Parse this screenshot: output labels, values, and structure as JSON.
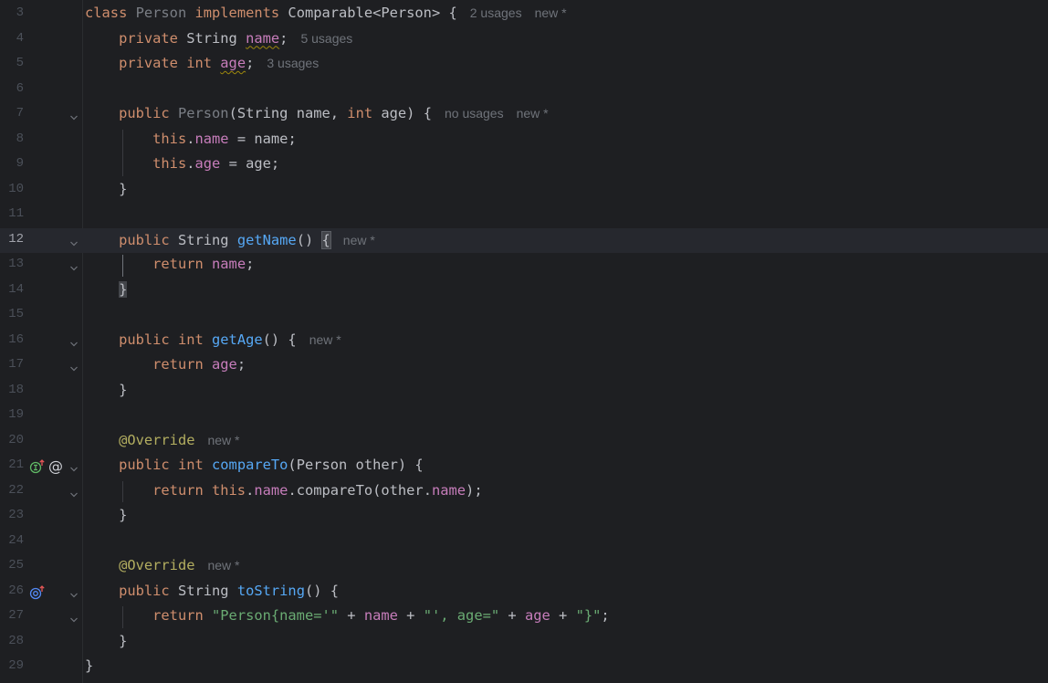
{
  "editor": {
    "current_line": 12,
    "lines": [
      {
        "num": "3",
        "tokens": [
          [
            "kw",
            "class "
          ],
          [
            "unused",
            "Person "
          ],
          [
            "kw",
            "implements "
          ],
          [
            "plain",
            "Comparable<Person> {"
          ]
        ],
        "hints": [
          "2 usages",
          "new *"
        ]
      },
      {
        "num": "4",
        "tokens": [
          [
            "plain",
            "    "
          ],
          [
            "kw",
            "private "
          ],
          [
            "plain",
            "String "
          ],
          [
            "fld sq",
            "name"
          ],
          [
            "plain",
            ";"
          ]
        ],
        "hints": [
          "5 usages"
        ]
      },
      {
        "num": "5",
        "tokens": [
          [
            "plain",
            "    "
          ],
          [
            "kw",
            "private int "
          ],
          [
            "fld sq",
            "age"
          ],
          [
            "plain",
            ";"
          ]
        ],
        "hints": [
          "3 usages"
        ]
      },
      {
        "num": "6",
        "tokens": [],
        "hints": []
      },
      {
        "num": "7",
        "tokens": [
          [
            "plain",
            "    "
          ],
          [
            "kw",
            "public "
          ],
          [
            "unused",
            "Person"
          ],
          [
            "plain",
            "(String name, "
          ],
          [
            "kw",
            "int "
          ],
          [
            "plain",
            "age) {"
          ]
        ],
        "hints": [
          "no usages",
          "new *"
        ],
        "fold": true
      },
      {
        "num": "8",
        "tokens": [
          [
            "plain",
            "        "
          ],
          [
            "kw",
            "this"
          ],
          [
            "plain",
            "."
          ],
          [
            "fld",
            "name"
          ],
          [
            "plain",
            " = name;"
          ]
        ],
        "hints": []
      },
      {
        "num": "9",
        "tokens": [
          [
            "plain",
            "        "
          ],
          [
            "kw",
            "this"
          ],
          [
            "plain",
            "."
          ],
          [
            "fld",
            "age"
          ],
          [
            "plain",
            " = age;"
          ]
        ],
        "hints": []
      },
      {
        "num": "10",
        "tokens": [
          [
            "plain",
            "    }"
          ]
        ],
        "hints": []
      },
      {
        "num": "11",
        "tokens": [],
        "hints": []
      },
      {
        "num": "12",
        "tokens": [
          [
            "plain",
            "    "
          ],
          [
            "kw",
            "public "
          ],
          [
            "plain",
            "String "
          ],
          [
            "fn",
            "getName"
          ],
          [
            "plain",
            "() "
          ],
          [
            "caret",
            ""
          ],
          [
            "brace",
            "{"
          ]
        ],
        "hints": [
          "new *"
        ],
        "fold": true
      },
      {
        "num": "13",
        "tokens": [
          [
            "plain",
            "        "
          ],
          [
            "kw",
            "return "
          ],
          [
            "fld",
            "name"
          ],
          [
            "plain",
            ";"
          ]
        ],
        "hints": [],
        "fold": true
      },
      {
        "num": "14",
        "tokens": [
          [
            "plain",
            "    "
          ],
          [
            "brace2",
            "}"
          ]
        ],
        "hints": []
      },
      {
        "num": "15",
        "tokens": [],
        "hints": []
      },
      {
        "num": "16",
        "tokens": [
          [
            "plain",
            "    "
          ],
          [
            "kw",
            "public int "
          ],
          [
            "fn",
            "getAge"
          ],
          [
            "plain",
            "() {"
          ]
        ],
        "hints": [
          "new *"
        ],
        "fold": true
      },
      {
        "num": "17",
        "tokens": [
          [
            "plain",
            "        "
          ],
          [
            "kw",
            "return "
          ],
          [
            "fld",
            "age"
          ],
          [
            "plain",
            ";"
          ]
        ],
        "hints": [],
        "fold": true
      },
      {
        "num": "18",
        "tokens": [
          [
            "plain",
            "    }"
          ]
        ],
        "hints": []
      },
      {
        "num": "19",
        "tokens": [],
        "hints": []
      },
      {
        "num": "20",
        "tokens": [
          [
            "plain",
            "    "
          ],
          [
            "ann",
            "@Override"
          ]
        ],
        "hints": [
          "new *"
        ]
      },
      {
        "num": "21",
        "tokens": [
          [
            "plain",
            "    "
          ],
          [
            "kw",
            "public int "
          ],
          [
            "fn",
            "compareTo"
          ],
          [
            "plain",
            "(Person other) {"
          ]
        ],
        "hints": [],
        "fold": true,
        "icons": [
          "implements-method-icon",
          "annotation-icon"
        ]
      },
      {
        "num": "22",
        "tokens": [
          [
            "plain",
            "        "
          ],
          [
            "kw",
            "return this"
          ],
          [
            "plain",
            "."
          ],
          [
            "fld",
            "name"
          ],
          [
            "plain",
            ".compareTo(other."
          ],
          [
            "fld",
            "name"
          ],
          [
            "plain",
            ");"
          ]
        ],
        "hints": [],
        "fold": true
      },
      {
        "num": "23",
        "tokens": [
          [
            "plain",
            "    }"
          ]
        ],
        "hints": []
      },
      {
        "num": "24",
        "tokens": [],
        "hints": []
      },
      {
        "num": "25",
        "tokens": [
          [
            "plain",
            "    "
          ],
          [
            "ann",
            "@Override"
          ]
        ],
        "hints": [
          "new *"
        ]
      },
      {
        "num": "26",
        "tokens": [
          [
            "plain",
            "    "
          ],
          [
            "kw",
            "public "
          ],
          [
            "plain",
            "String "
          ],
          [
            "fn",
            "toString"
          ],
          [
            "plain",
            "() {"
          ]
        ],
        "hints": [],
        "fold": true,
        "icons": [
          "overrides-method-icon"
        ]
      },
      {
        "num": "27",
        "tokens": [
          [
            "plain",
            "        "
          ],
          [
            "kw",
            "return "
          ],
          [
            "str",
            "\"Person{name='\""
          ],
          [
            "plain",
            " + "
          ],
          [
            "fld",
            "name"
          ],
          [
            "plain",
            " + "
          ],
          [
            "str",
            "\"', age=\""
          ],
          [
            "plain",
            " + "
          ],
          [
            "fld",
            "age"
          ],
          [
            "plain",
            " + "
          ],
          [
            "str",
            "\"}\""
          ],
          [
            "plain",
            ";"
          ]
        ],
        "hints": [],
        "fold": true
      },
      {
        "num": "28",
        "tokens": [
          [
            "plain",
            "    }"
          ]
        ],
        "hints": []
      },
      {
        "num": "29",
        "tokens": [
          [
            "plain",
            "}"
          ]
        ],
        "hints": []
      }
    ]
  },
  "colors": {
    "background": "#1e1f22",
    "current_line": "#26282e",
    "keyword": "#cf8e6d",
    "field": "#c77dbb",
    "method": "#56a8f5",
    "annotation": "#b3ae60",
    "string": "#6aab73",
    "hint": "#6f737a",
    "implements_icon": "#5fb865",
    "override_icon": "#548af7"
  }
}
